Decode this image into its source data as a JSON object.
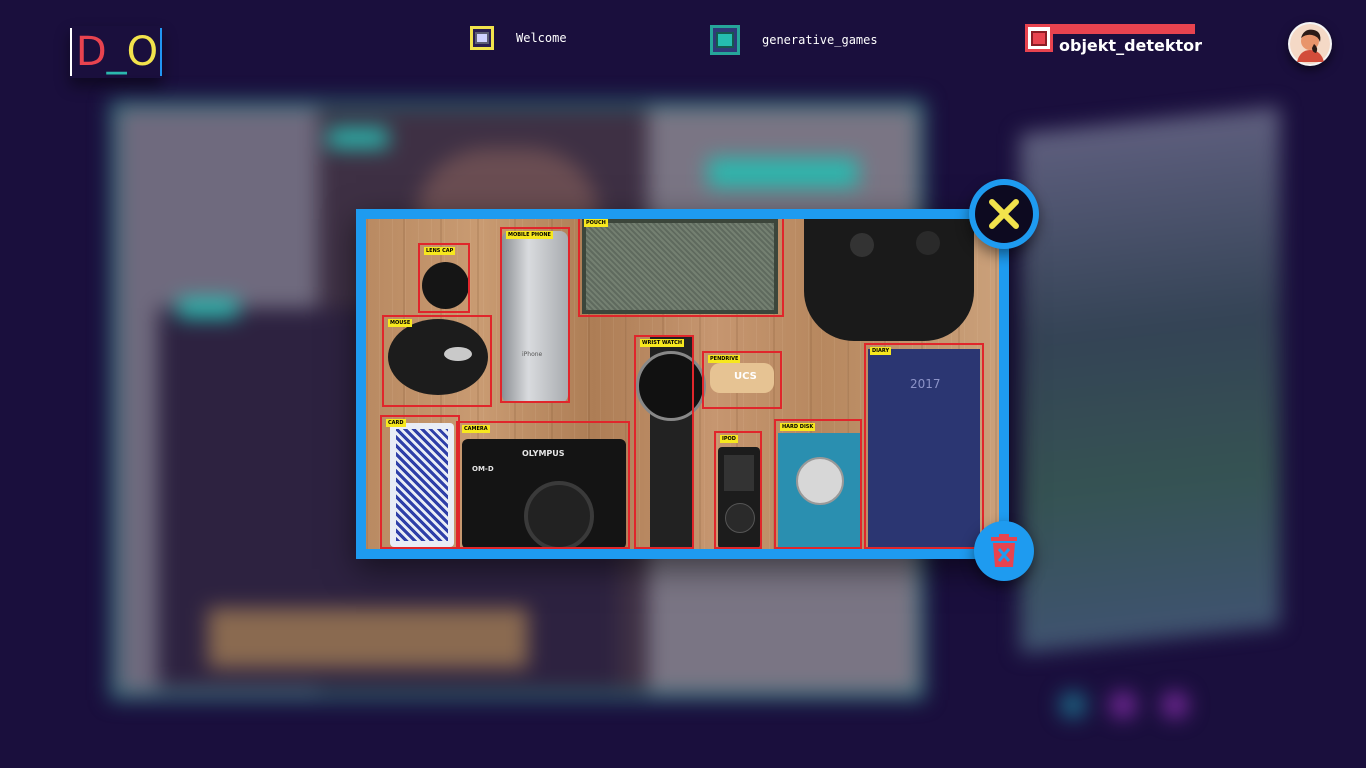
{
  "app": {
    "logo_letters": {
      "d": "D",
      "underscore": "_",
      "o": "O"
    }
  },
  "nav": {
    "items": [
      {
        "label": "Welcome",
        "icon": "window-icon",
        "accent": "#f2e34c",
        "active": false
      },
      {
        "label": "generative_games",
        "icon": "window-icon",
        "accent": "#26a69a",
        "active": false
      },
      {
        "label": "objekt_detektor",
        "icon": "window-icon",
        "accent": "#e8434f",
        "active": true
      }
    ]
  },
  "user": {
    "avatar_icon": "user-avatar-icon"
  },
  "modal": {
    "border_color": "#1e9bf0",
    "close_icon": "close-x-icon",
    "close_icon_color": "#f2e34c",
    "delete_icon": "trash-icon",
    "delete_icon_color": "#e8434f",
    "detections": [
      {
        "label": "LENS CAP"
      },
      {
        "label": "MOBILE PHONE"
      },
      {
        "label": "POUCH"
      },
      {
        "label": "MOUSE"
      },
      {
        "label": "WRIST WATCH"
      },
      {
        "label": "PENDRIVE"
      },
      {
        "label": "DIARY"
      },
      {
        "label": "CARD"
      },
      {
        "label": "CAMERA"
      },
      {
        "label": "IPOD"
      },
      {
        "label": "HARD DISK"
      }
    ],
    "object_text": {
      "camera_brand": "OLYMPUS",
      "camera_model": "OM-D",
      "diary_year": "2017",
      "pendrive_text": "UCS",
      "phone_text": "iPhone"
    }
  },
  "theme": {
    "background": "#1a0f3d",
    "detection_box": "#e0262b",
    "detection_label_bg": "#f7e81e"
  }
}
